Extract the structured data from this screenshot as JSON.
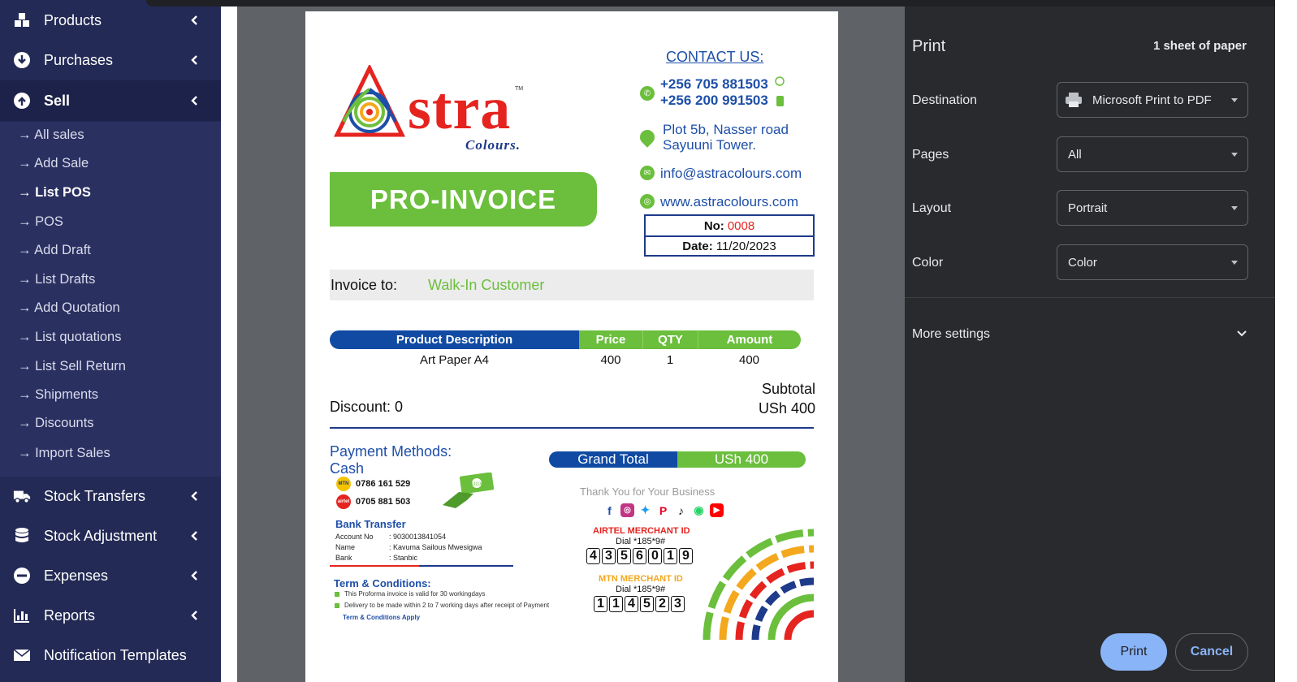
{
  "sidebar": {
    "items_top": [
      {
        "label": "Products",
        "icon": "boxes-icon"
      },
      {
        "label": "Purchases",
        "icon": "download-circle-icon"
      },
      {
        "label": "Sell",
        "icon": "upload-circle-icon"
      }
    ],
    "sub_items": [
      "→ All sales",
      "→ Add Sale",
      "→ List POS",
      "→ POS",
      "→ Add Draft",
      "→ List Drafts",
      "→ Add Quotation",
      "→ List quotations",
      "→ List Sell Return",
      "→ Shipments",
      "→ Discounts",
      "→ Import Sales"
    ],
    "items_bottom": [
      {
        "label": "Stock Transfers",
        "icon": "truck-icon"
      },
      {
        "label": "Stock Adjustment",
        "icon": "database-icon"
      },
      {
        "label": "Expenses",
        "icon": "minus-circle-icon"
      },
      {
        "label": "Reports",
        "icon": "bar-chart-icon"
      },
      {
        "label": "Notification Templates",
        "icon": "envelope-icon"
      }
    ]
  },
  "invoice": {
    "logo_text": "stra",
    "logo_sub": "Colours.",
    "logo_tm": "TM",
    "title": "PRO-INVOICE",
    "contact_title": "CONTACT US:",
    "phone1": "+256 705 881503",
    "phone2": "+256 200 991503",
    "address1": "Plot 5b, Nasser road",
    "address2": "Sayuuni Tower.",
    "email": "info@astracolours.com",
    "website": "www.astracolours.com",
    "no_label": "No:",
    "no_value": "0008",
    "date_label": "Date:",
    "date_value": "11/20/2023",
    "invoice_to_label": "Invoice to:",
    "invoice_to_value": "Walk-In Customer",
    "table": {
      "headers": {
        "desc": "Product Description",
        "price": "Price",
        "qty": "QTY",
        "amount": "Amount"
      },
      "rows": [
        {
          "desc": "Art Paper A4",
          "price": "400",
          "qty": "1",
          "amount": "400"
        }
      ]
    },
    "discount": "Discount: 0",
    "subtotal_label": "Subtotal",
    "subtotal_value": "USh 400",
    "payment_title": "Payment Methods:",
    "payment_value": "Cash",
    "grand_total_label": "Grand Total",
    "grand_total_value": "USh 400",
    "mtn_number": "0786 161 529",
    "mtn_tag": "MTN",
    "airtel_number": "0705 881 503",
    "airtel_tag": "airtel",
    "bank_title": "Bank Transfer",
    "bank": {
      "account_label": "Account No",
      "account_value": ": 9030013841054",
      "name_label": "Name",
      "name_value": ": Kavuma Sailous Mwesigwa",
      "bank_label": "Bank",
      "bank_value": ": Stanbic"
    },
    "terms_title": "Term & Conditions:",
    "terms": [
      "This Proforma invoice is valid for 30 workingdays",
      "Delivery to be made within 2 to 7 working days after receipt of  Payment"
    ],
    "terms_apply": "Term & Conditions Apply",
    "thanks": "Thank You for Your Business",
    "airtel_merchant_title": "AIRTEL MERCHANT ID",
    "airtel_dial": "Dial *185*9#",
    "airtel_digits": [
      "4",
      "3",
      "5",
      "6",
      "0",
      "1",
      "9"
    ],
    "mtn_merchant_title": "MTN MERCHANT ID",
    "mtn_dial": "Dial *185*9#",
    "mtn_digits": [
      "1",
      "1",
      "4",
      "5",
      "2",
      "3"
    ],
    "money_tag": "UGX",
    "colors": {
      "green": "#6bbf3c",
      "blue": "#104aa3",
      "red": "#e52420"
    }
  },
  "print_panel": {
    "title": "Print",
    "sheets": "1 sheet of paper",
    "destination_label": "Destination",
    "destination_value": "Microsoft Print to PDF",
    "pages_label": "Pages",
    "pages_value": "All",
    "layout_label": "Layout",
    "layout_value": "Portrait",
    "color_label": "Color",
    "color_value": "Color",
    "more_settings": "More settings",
    "print_button": "Print",
    "cancel_button": "Cancel"
  }
}
